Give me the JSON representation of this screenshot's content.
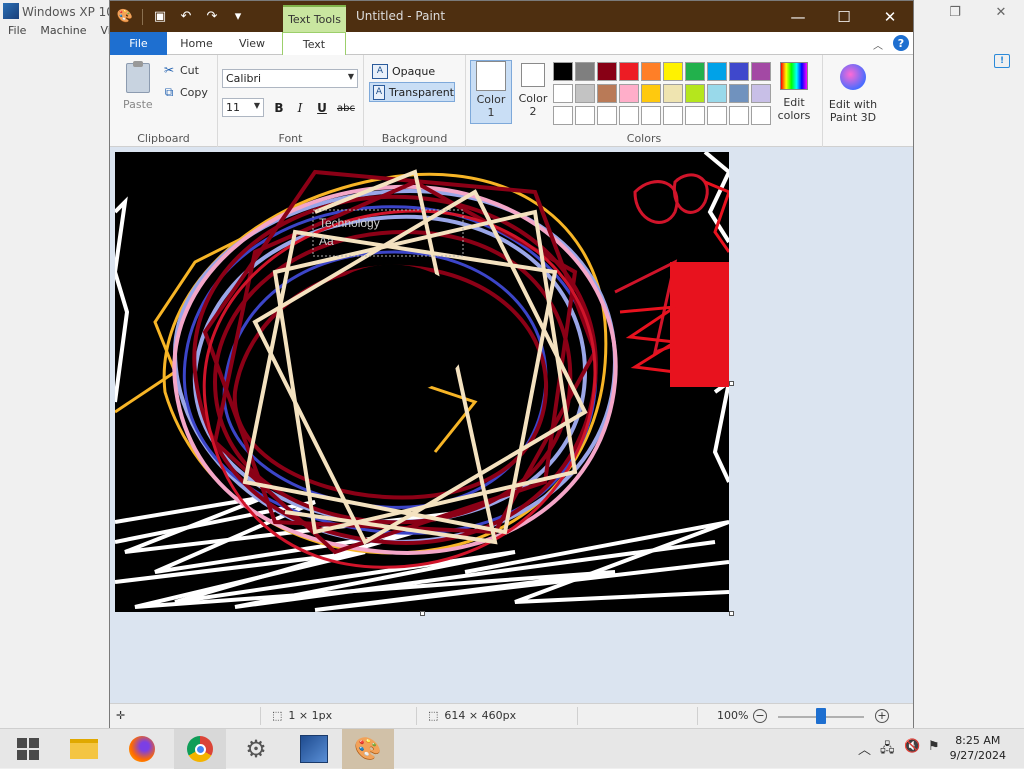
{
  "background_window": {
    "title": "Windows XP 10",
    "menu": [
      "File",
      "Machine",
      "Vie"
    ]
  },
  "paint": {
    "title": "Untitled - Paint",
    "context_tab": "Text Tools",
    "tabs": {
      "file": "File",
      "home": "Home",
      "view": "View",
      "text": "Text"
    },
    "ribbon": {
      "clipboard": {
        "paste": "Paste",
        "cut": "Cut",
        "copy": "Copy",
        "label": "Clipboard"
      },
      "font": {
        "family": "Calibri",
        "size": "11",
        "bold": "B",
        "italic": "I",
        "underline": "U",
        "strike": "abc",
        "label": "Font"
      },
      "background": {
        "opaque": "Opaque",
        "transparent": "Transparent",
        "label": "Background"
      },
      "colors": {
        "color1_label": "Color\n1",
        "color1_line1": "Color",
        "color1_line2": "1",
        "color2_line1": "Color",
        "color2_line2": "2",
        "color1": "#ffffff",
        "color2": "#ffffff",
        "palette": [
          "#000000",
          "#7f7f7f",
          "#880015",
          "#ed1c24",
          "#ff7f27",
          "#fff200",
          "#22b14c",
          "#00a2e8",
          "#3f48cc",
          "#a349a4",
          "#ffffff",
          "#c3c3c3",
          "#b97a57",
          "#ffaec9",
          "#ffc90e",
          "#efe4b0",
          "#b5e61d",
          "#99d9ea",
          "#7092be",
          "#c8bfe7",
          "#ffffff",
          "#ffffff",
          "#ffffff",
          "#ffffff",
          "#ffffff",
          "#ffffff",
          "#ffffff",
          "#ffffff",
          "#ffffff",
          "#ffffff"
        ],
        "edit_colors_line1": "Edit",
        "edit_colors_line2": "colors",
        "label": "Colors"
      },
      "paint3d": {
        "line1": "Edit with",
        "line2": "Paint 3D"
      }
    },
    "canvas_text": [
      "Technology",
      "Aa"
    ],
    "status": {
      "selection": "1 × 1px",
      "size": "614 × 460px",
      "zoom": "100%"
    }
  },
  "taskbar": {
    "time": "8:25 AM",
    "date": "9/27/2024"
  }
}
